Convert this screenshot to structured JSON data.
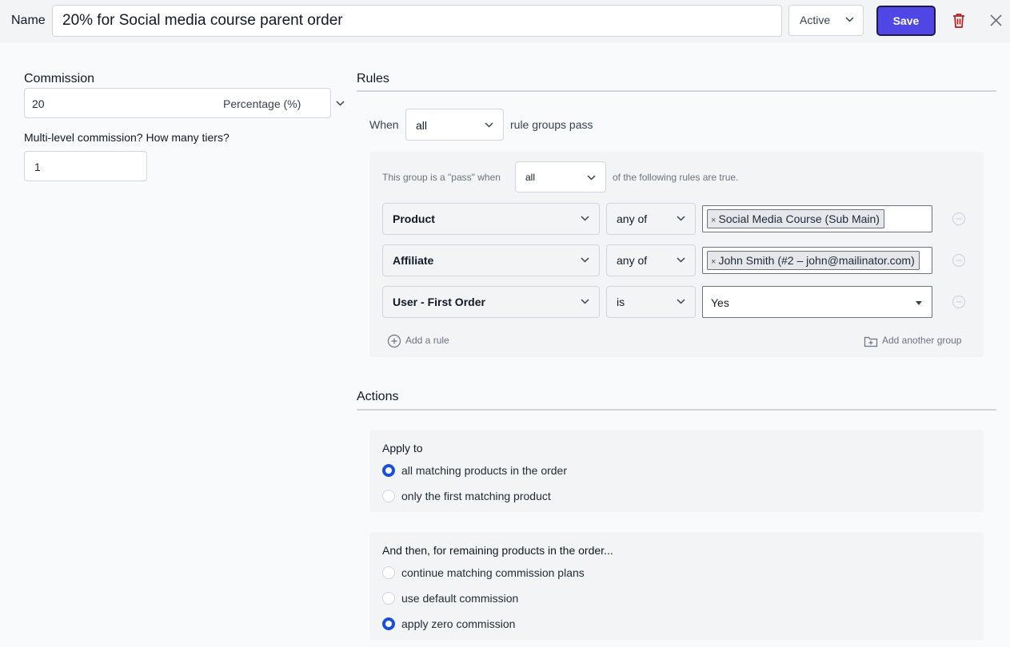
{
  "header": {
    "name_label": "Name",
    "name_value": "20% for Social media course parent order",
    "status": "Active",
    "save_label": "Save"
  },
  "commission": {
    "label": "Commission",
    "value": "20",
    "unit": "Percentage (%)",
    "tiers_label": "Multi-level commission? How many tiers?",
    "tiers_value": "1"
  },
  "rules": {
    "title": "Rules",
    "when_label": "When",
    "when_value": "all",
    "pass_label": "rule groups pass",
    "group": {
      "prefix": "This group is a \"pass\" when",
      "match_value": "all",
      "suffix": "of the following rules are true."
    },
    "items": [
      {
        "field": "Product",
        "operator": "any of",
        "value": "Social Media Course (Sub Main)"
      },
      {
        "field": "Affiliate",
        "operator": "any of",
        "value": "John Smith (#2 – john@mailinator.com)"
      },
      {
        "field": "User - First Order",
        "operator": "is",
        "value": "Yes"
      }
    ],
    "add_rule_label": "Add a rule",
    "add_group_label": "Add another group"
  },
  "actions": {
    "title": "Actions",
    "apply_to": {
      "title": "Apply to",
      "options": [
        {
          "label": "all matching products in the order",
          "selected": true
        },
        {
          "label": "only the first matching product",
          "selected": false
        }
      ]
    },
    "remaining": {
      "title": "And then, for remaining products in the order...",
      "options": [
        {
          "label": "continue matching commission plans",
          "selected": false
        },
        {
          "label": "use default commission",
          "selected": false
        },
        {
          "label": "apply zero commission",
          "selected": true
        }
      ]
    }
  },
  "colors": {
    "accent": "#4f46e5",
    "radio_selected": "#1d4ed8",
    "trash": "#b91c1c"
  }
}
